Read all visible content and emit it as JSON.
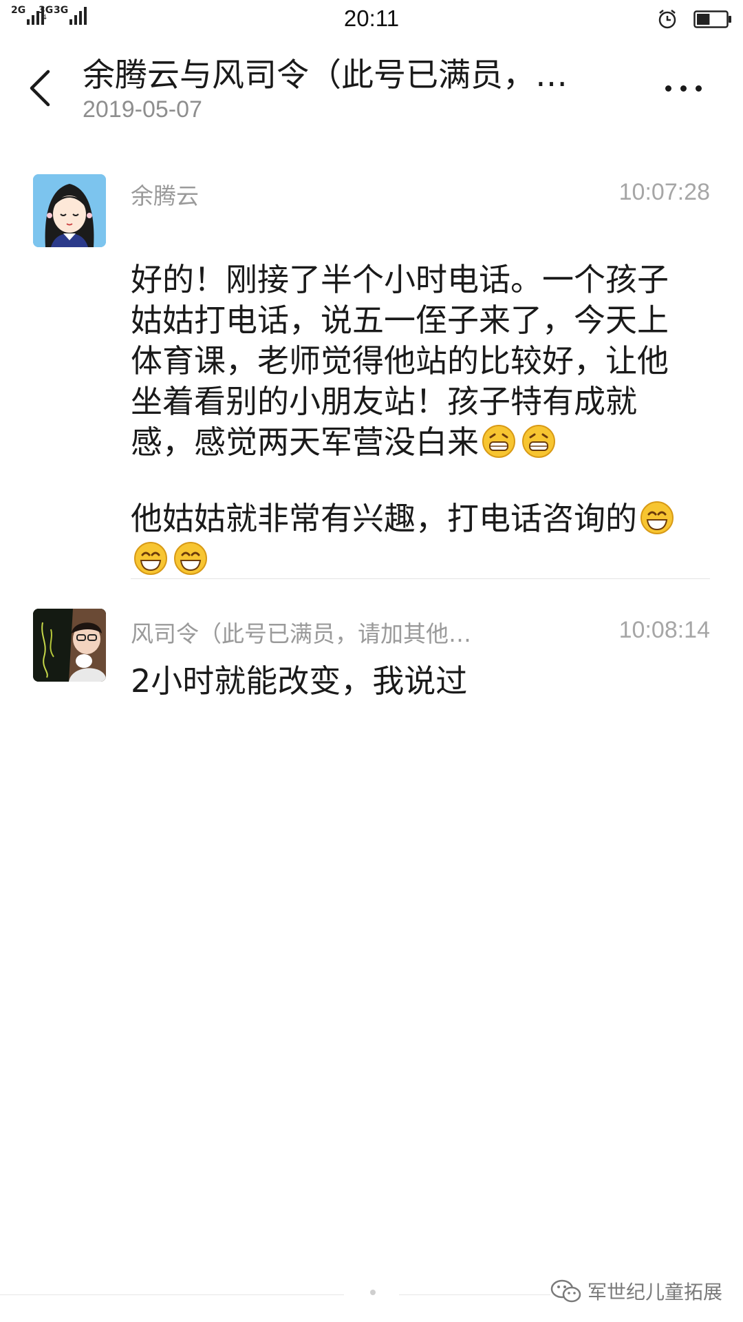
{
  "status_bar": {
    "sim1_label": "2G",
    "sim2_label": "3G",
    "sim3_label": "3G",
    "time": "20:11",
    "battery_level_percent": 45
  },
  "header": {
    "title": "余腾云与风司令（此号已满员，…",
    "date": "2019-05-07"
  },
  "messages": [
    {
      "sender": "余腾云",
      "time": "10:07:28",
      "paragraph1": "好的！刚接了半个小时电话。一个孩子姑姑打电话，说五一侄子来了，今天上体育课，老师觉得他站的比较好，让他坐着看别的小朋友站！孩子特有成就感，感觉两天军营没白来",
      "paragraph2": "他姑姑就非常有兴趣，打电话咨询的"
    },
    {
      "sender": "风司令（此号已满员，请加其他…",
      "time": "10:08:14",
      "text": "2小时就能改变，我说过"
    }
  ],
  "watermark": {
    "text": "军世纪儿童拓展"
  },
  "colors": {
    "avatar1_bg": "#7cc4ee",
    "secondary_text": "#9a9a9a",
    "primary_text": "#1a1a1a"
  }
}
